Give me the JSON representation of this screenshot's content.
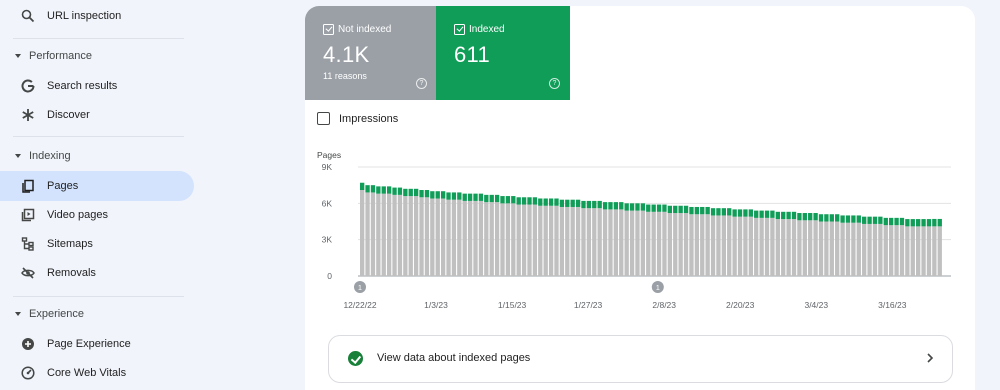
{
  "sidebar": {
    "url_inspection": {
      "label": "URL inspection",
      "icon": "search-icon"
    },
    "sections": [
      {
        "label": "Performance",
        "items": [
          {
            "label": "Search results",
            "icon": "google-g-icon"
          },
          {
            "label": "Discover",
            "icon": "asterisk-icon"
          }
        ]
      },
      {
        "label": "Indexing",
        "items": [
          {
            "label": "Pages",
            "icon": "pages-icon",
            "active": true
          },
          {
            "label": "Video pages",
            "icon": "video-pages-icon"
          },
          {
            "label": "Sitemaps",
            "icon": "sitemap-icon"
          },
          {
            "label": "Removals",
            "icon": "eye-off-icon"
          }
        ]
      },
      {
        "label": "Experience",
        "items": [
          {
            "label": "Page Experience",
            "icon": "plus-circle-icon"
          },
          {
            "label": "Core Web Vitals",
            "icon": "gauge-icon"
          }
        ]
      }
    ]
  },
  "summary": {
    "not_indexed": {
      "label": "Not indexed",
      "value": "4.1K",
      "sub": "11 reasons",
      "color": "#9aa0a6"
    },
    "indexed": {
      "label": "Indexed",
      "value": "611",
      "color": "#0f9d58"
    }
  },
  "impressions_label": "Impressions",
  "chart_data": {
    "type": "bar",
    "stacked": true,
    "ylabel": "Pages",
    "y_ticks": [
      "0",
      "3K",
      "6K",
      "9K"
    ],
    "ylim": [
      0,
      9000
    ],
    "x_tick_labels": [
      "12/22/22",
      "1/3/23",
      "1/15/23",
      "1/27/23",
      "2/8/23",
      "2/20/23",
      "3/4/23",
      "3/16/23"
    ],
    "annotations": [
      {
        "label": "1",
        "date": "12/22/22"
      },
      {
        "label": "1",
        "date": "2/7/23"
      }
    ],
    "series": [
      {
        "name": "Not indexed",
        "color": "#c0c0c0",
        "values": [
          7100,
          6900,
          6900,
          6800,
          6800,
          6800,
          6700,
          6700,
          6600,
          6600,
          6600,
          6500,
          6500,
          6400,
          6400,
          6400,
          6300,
          6300,
          6300,
          6200,
          6200,
          6200,
          6200,
          6100,
          6100,
          6100,
          6000,
          6000,
          6000,
          5900,
          5900,
          5900,
          5900,
          5800,
          5800,
          5800,
          5800,
          5700,
          5700,
          5700,
          5700,
          5600,
          5600,
          5600,
          5600,
          5500,
          5500,
          5500,
          5500,
          5400,
          5400,
          5400,
          5400,
          5300,
          5300,
          5300,
          5300,
          5200,
          5200,
          5200,
          5200,
          5100,
          5100,
          5100,
          5100,
          5000,
          5000,
          5000,
          5000,
          4900,
          4900,
          4900,
          4900,
          4800,
          4800,
          4800,
          4800,
          4700,
          4700,
          4700,
          4700,
          4600,
          4600,
          4600,
          4600,
          4500,
          4500,
          4500,
          4500,
          4400,
          4400,
          4400,
          4400,
          4300,
          4300,
          4300,
          4300,
          4200,
          4200,
          4200,
          4200,
          4100,
          4100,
          4100,
          4100,
          4100,
          4100,
          4100
        ]
      },
      {
        "name": "Indexed",
        "color": "#0f9d58",
        "values": [
          600,
          600,
          600,
          600,
          600,
          600,
          600,
          600,
          600,
          600,
          600,
          600,
          600,
          600,
          600,
          600,
          600,
          600,
          600,
          600,
          600,
          600,
          600,
          600,
          600,
          600,
          600,
          600,
          600,
          600,
          600,
          600,
          600,
          600,
          600,
          600,
          600,
          600,
          600,
          600,
          600,
          600,
          600,
          600,
          600,
          600,
          600,
          600,
          600,
          600,
          600,
          600,
          600,
          600,
          600,
          600,
          600,
          600,
          600,
          600,
          600,
          600,
          600,
          600,
          600,
          600,
          600,
          600,
          600,
          600,
          600,
          600,
          600,
          600,
          600,
          600,
          600,
          600,
          600,
          600,
          600,
          600,
          600,
          600,
          600,
          600,
          600,
          600,
          600,
          600,
          600,
          600,
          600,
          600,
          600,
          600,
          600,
          600,
          600,
          600,
          600,
          600,
          600,
          600,
          600,
          600,
          611,
          611
        ]
      }
    ]
  },
  "view_button": {
    "label": "View data about indexed pages"
  }
}
